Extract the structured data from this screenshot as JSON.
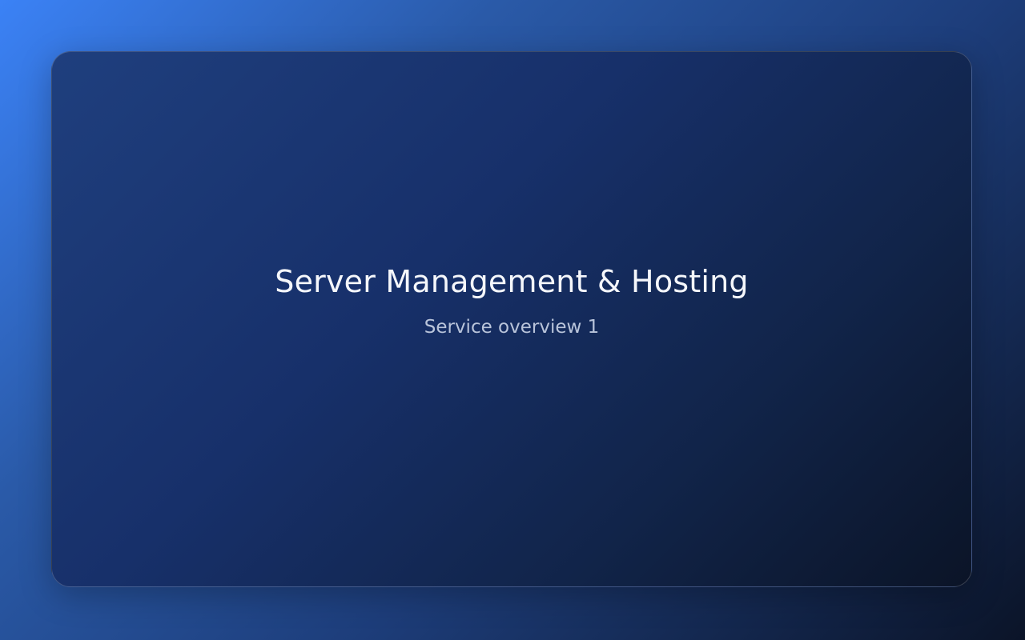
{
  "card": {
    "title": "Server Management & Hosting",
    "subtitle": "Service overview 1"
  },
  "colors": {
    "page_gradient_start": "#3b82f6",
    "page_gradient_end": "#0b1428",
    "card_gradient_start": "#1f3f7e",
    "card_gradient_end": "#0b1427",
    "title_text": "#f5f7fb",
    "subtitle_text": "#b9c4da"
  }
}
